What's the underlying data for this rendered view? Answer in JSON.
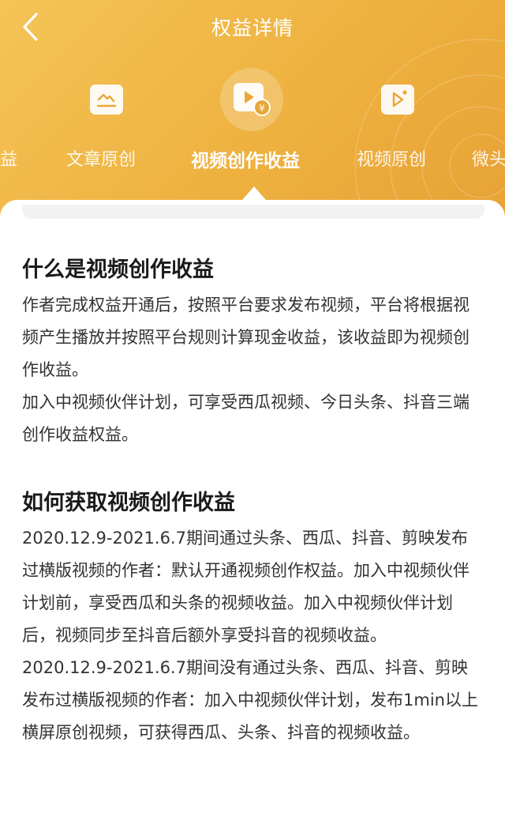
{
  "header": {
    "title": "权益详情",
    "colors": {
      "bg_start": "#f4c457",
      "bg_end": "#e7a236"
    }
  },
  "tabs": [
    {
      "label": "益",
      "icon": null
    },
    {
      "label": "文章原创",
      "icon": "article-chart-icon"
    },
    {
      "label": "视频创作收益",
      "icon": "video-revenue-icon",
      "active": true
    },
    {
      "label": "视频原创",
      "icon": "video-play-icon"
    },
    {
      "label": "微头",
      "icon": null
    }
  ],
  "sections": [
    {
      "title": "什么是视频创作收益",
      "paragraphs": [
        "作者完成权益开通后，按照平台要求发布视频，平台将根据视频产生播放并按照平台规则计算现金收益，该收益即为视频创作收益。",
        "加入中视频伙伴计划，可享受西瓜视频、今日头条、抖音三端创作收益权益。"
      ]
    },
    {
      "title": "如何获取视频创作收益",
      "paragraphs": [
        "2020.12.9-2021.6.7期间通过头条、西瓜、抖音、剪映发布过横版视频的作者：默认开通视频创作权益。加入中视频伙伴计划前，享受西瓜和头条的视频收益。加入中视频伙伴计划后，视频同步至抖音后额外享受抖音的视频收益。",
        "2020.12.9-2021.6.7期间没有通过头条、西瓜、抖音、剪映发布过横版视频的作者：加入中视频伙伴计划，发布1min以上横屏原创视频，可获得西瓜、头条、抖音的视频收益。"
      ]
    }
  ]
}
